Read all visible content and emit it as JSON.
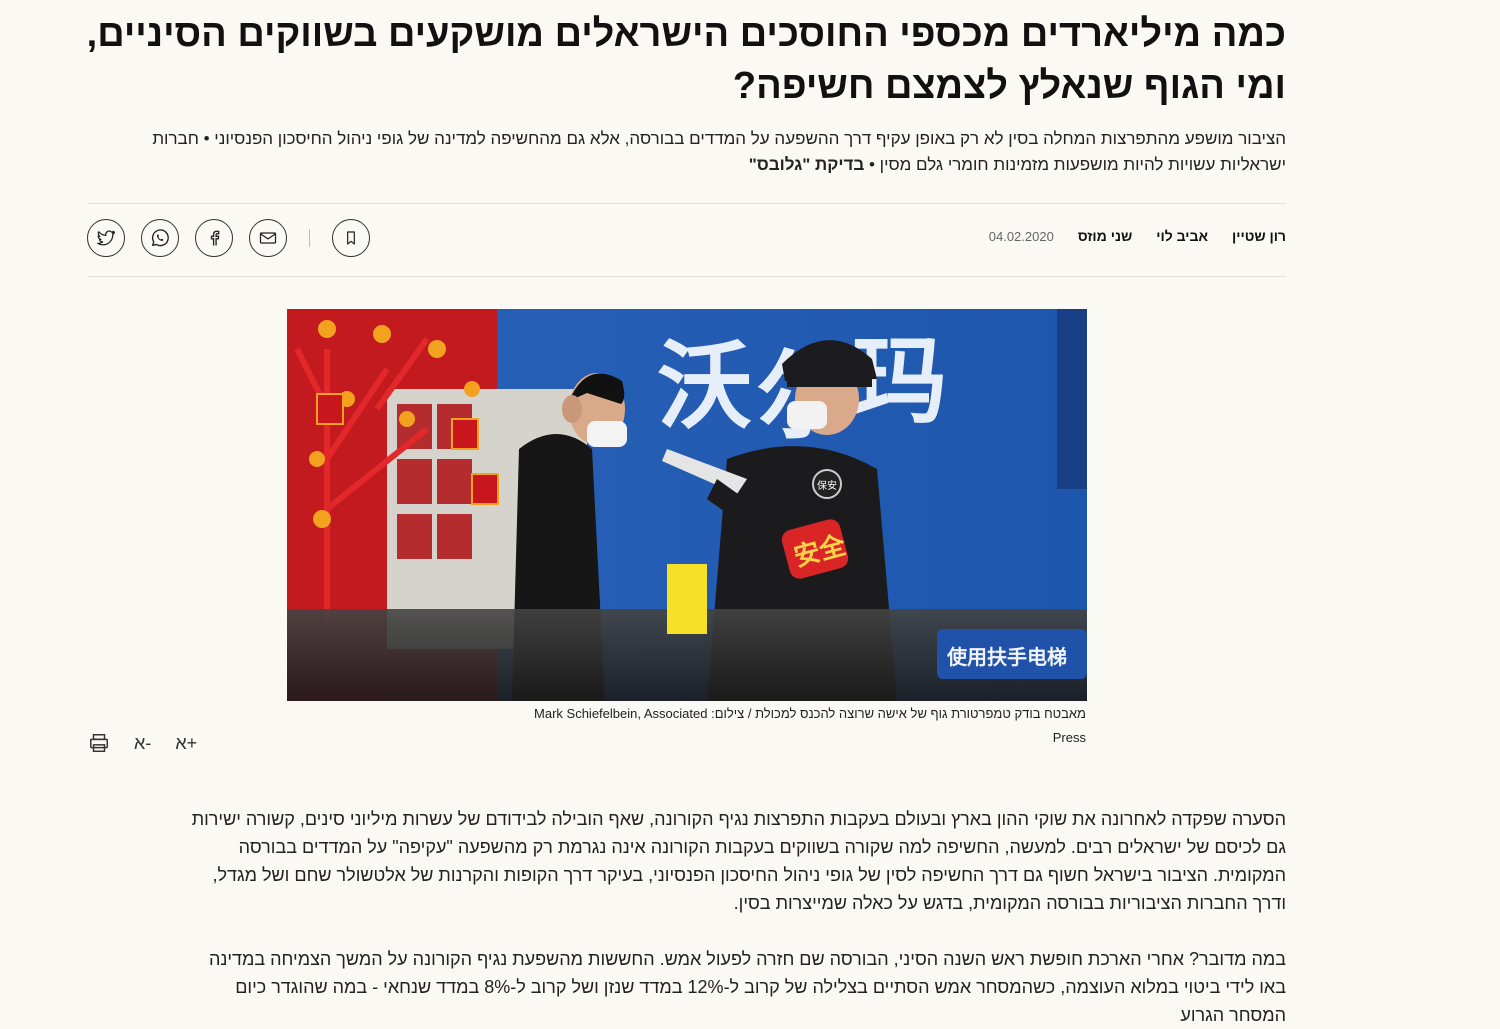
{
  "article": {
    "headline_line1": "כמה מיליארדים מכספי החוסכים הישראלים מושקעים בשווקים הסיניים,",
    "headline_line2": "ומי הגוף שנאלץ לצמצם חשיפה?",
    "subtitle_text": "הציבור מושפע מהתפרצות המחלה בסין לא רק באופן עקיף דרך ההשפעה על המדדים בבורסה, אלא גם מהחשיפה למדינה של גופי ניהול החיסכון הפנסיוני • חברות ישראליות עשויות להיות מושפעות מזמינות חומרי גלם מסין • ",
    "subtitle_bold": "בדיקת \"גלובס\"",
    "authors": [
      "רון שטיין",
      "אביב לוי",
      "שני מוזס"
    ],
    "date": "04.02.2020",
    "caption": "מאבטח בודק טמפרטורת גוף של אישה שרוצה להכנס למכולת / צילום: Mark Schiefelbein, Associated Press",
    "paragraph1": "הסערה שפקדה לאחרונה את שוקי ההון בארץ ובעולם בעקבות התפרצות נגיף הקורונה, שאף הובילה לבידודם של עשרות מיליוני סינים, קשורה ישירות גם לכיסם של ישראלים רבים. למעשה, החשיפה למה שקורה בשווקים בעקבות הקורונה אינה נגרמת רק מהשפעה \"עקיפה\" על המדדים בבורסה המקומית. הציבור בישראל חשוף גם דרך החשיפה לסין של גופי ניהול החיסכון הפנסיוני, בעיקר דרך הקופות והקרנות של אלטשולר שחם ושל מגדל, ודרך החברות הציבוריות בבורסה המקומית, בדגש על כאלה שמייצרות בסין.",
    "paragraph2": "במה מדובר? אחרי הארכת חופשת ראש השנה הסיני, הבורסה שם חזרה לפעול אמש. החששות מהשפעת נגיף הקורונה על המשך הצמיחה במדינה באו לידי ביטוי במלוא העוצמה, כשהמסחר אמש הסתיים בצלילה של קרוב ל-12% במדד שנזן ושל קרוב ל-8% במדד שנחאי - במה שהוגדר כיום המסחר הגרוע"
  },
  "photo": {
    "sign_chars": [
      "沃",
      "尔",
      "玛"
    ],
    "armband_text": "安全",
    "badge_text": "保安",
    "escalator_sign": "使用扶手电梯"
  },
  "tools": {
    "font_increase": "א+",
    "font_decrease": "א-"
  },
  "icons": {
    "share": [
      "twitter-icon",
      "whatsapp-icon",
      "facebook-icon",
      "mail-icon"
    ],
    "save": "bookmark-icon",
    "print": "print-icon"
  }
}
